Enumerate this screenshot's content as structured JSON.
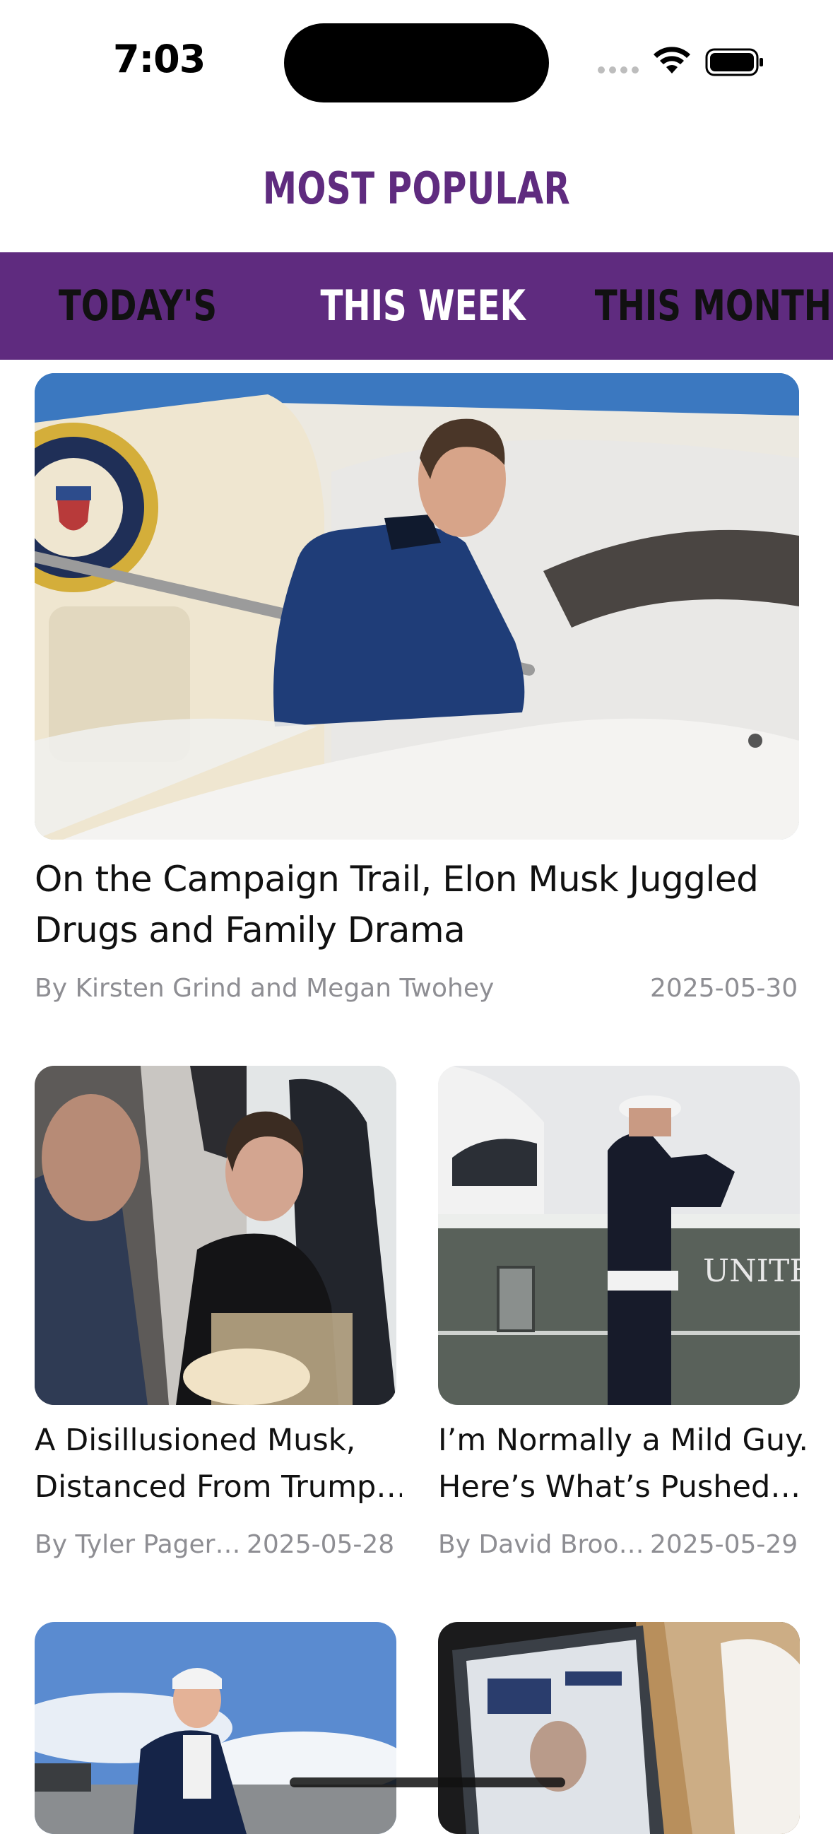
{
  "status": {
    "time": "7:03"
  },
  "header": {
    "title": "MOST POPULAR"
  },
  "tabs": [
    {
      "label": "TODAY'S",
      "active": false
    },
    {
      "label": "THIS WEEK",
      "active": true
    },
    {
      "label": "THIS MONTH",
      "active": false
    }
  ],
  "articles": [
    {
      "title": "On the Campaign Trail, Elon Musk Juggled Drugs and Family Drama",
      "author": "By Kirsten Grind and Megan Twohey",
      "date": "2025-05-30",
      "image": "photo-musk-airplane-stairs"
    },
    {
      "title_line1": "A Disillusioned Musk,",
      "title_line2": "Distanced From Trump…",
      "author": "By Tyler Pager…",
      "date": "2025-05-28",
      "image": "photo-musk-at-table"
    },
    {
      "title_line1": "I’m Normally a Mild Guy.",
      "title_line2": "Here’s What’s Pushed…",
      "author": "By David Broo…",
      "date": "2025-05-29",
      "image": "photo-marine-saluting-helicopter"
    },
    {
      "image": "photo-trump-on-tarmac"
    },
    {
      "image": "photo-laptop-screen"
    }
  ],
  "colors": {
    "brand_purple": "#5f2b7f",
    "meta_gray": "#8e8e93"
  }
}
